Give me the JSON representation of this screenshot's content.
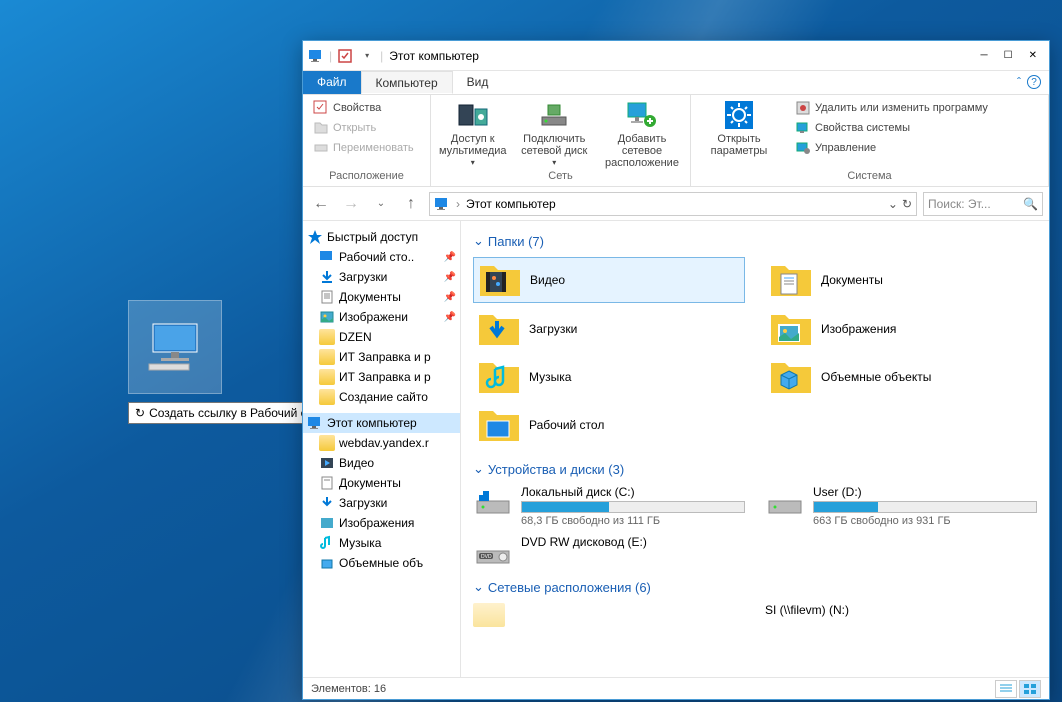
{
  "desktop": {
    "tooltip": "Создать ссылку в Рабочий стол"
  },
  "window": {
    "title": "Этот компьютер"
  },
  "ribbon_tabs": {
    "file": "Файл",
    "computer": "Компьютер",
    "view": "Вид"
  },
  "ribbon": {
    "group_location": {
      "label": "Расположение",
      "props": "Свойства",
      "open": "Открыть",
      "rename": "Переименовать"
    },
    "group_network": {
      "label": "Сеть",
      "media": "Доступ к мультимедиа",
      "map": "Подключить сетевой диск",
      "add": "Добавить сетевое расположение"
    },
    "group_system": {
      "label": "Система",
      "open_params": "Открыть параметры",
      "uninstall": "Удалить или изменить программу",
      "sysprops": "Свойства системы",
      "manage": "Управление"
    }
  },
  "address": {
    "location": "Этот компьютер"
  },
  "search": {
    "placeholder": "Поиск: Эт..."
  },
  "sidebar": {
    "quick": "Быстрый доступ",
    "items": [
      "Рабочий сто..",
      "Загрузки",
      "Документы",
      "Изображени",
      "DZEN",
      "ИТ Заправка и р",
      "ИТ Заправка и р",
      "Создание сайто"
    ],
    "thispc": "Этот компьютер",
    "pc_items": [
      "webdav.yandex.r",
      "Видео",
      "Документы",
      "Загрузки",
      "Изображения",
      "Музыка",
      "Объемные объ"
    ]
  },
  "content": {
    "folders_header": "Папки (7)",
    "folders": [
      "Видео",
      "Документы",
      "Загрузки",
      "Изображения",
      "Музыка",
      "Объемные объекты",
      "Рабочий стол"
    ],
    "drives_header": "Устройства и диски (3)",
    "drive_c": {
      "name": "Локальный диск (C:)",
      "sub": "68,3 ГБ свободно из 111 ГБ",
      "fill": 39
    },
    "drive_d": {
      "name": "User (D:)",
      "sub": "663 ГБ свободно из 931 ГБ",
      "fill": 29
    },
    "drive_e": {
      "name": "DVD RW дисковод (E:)"
    },
    "netloc_header": "Сетевые расположения (6)",
    "netloc_item": "SI (\\\\filevm) (N:)"
  },
  "statusbar": {
    "count": "Элементов: 16"
  }
}
